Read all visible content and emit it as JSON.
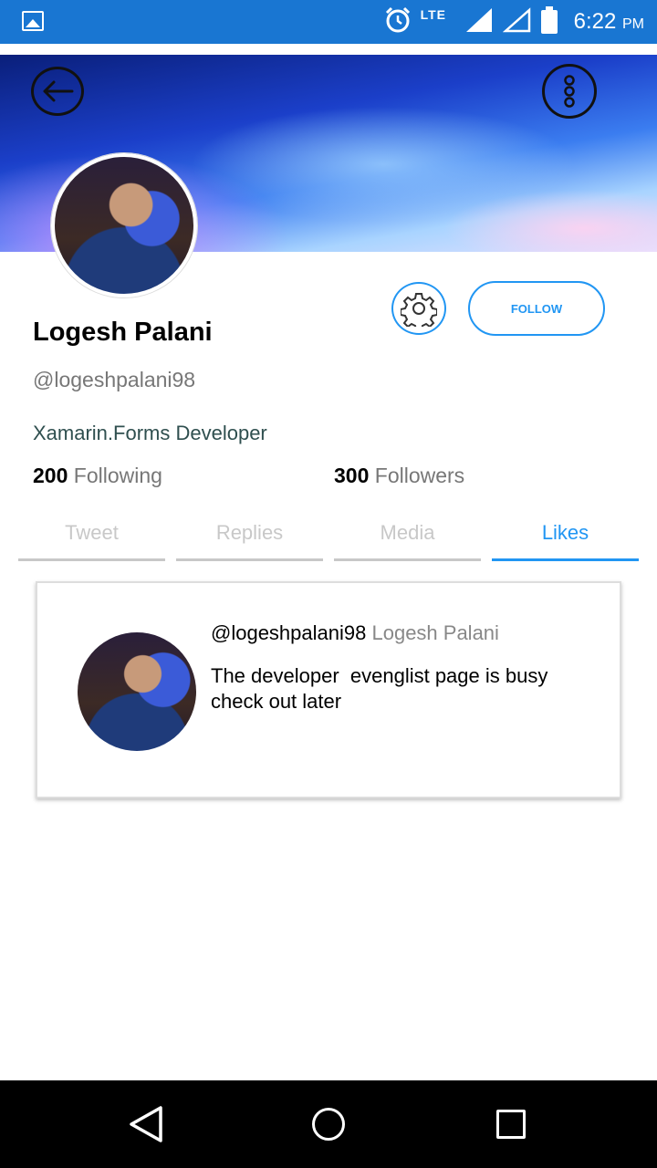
{
  "status_bar": {
    "time": "6:22",
    "ampm": "PM",
    "network": "LTE",
    "icons": [
      "gallery-icon",
      "alarm-icon",
      "lte-icon",
      "signal-icon",
      "signal-empty-icon",
      "battery-icon"
    ]
  },
  "header": {
    "back_icon": "arrow-left-icon",
    "more_icon": "more-vertical-icon"
  },
  "profile": {
    "name": "Logesh Palani",
    "handle": "@logeshpalani98",
    "bio": "Xamarin.Forms Developer",
    "following_count": "200",
    "following_label": "Following",
    "followers_count": "300",
    "followers_label": "Followers",
    "follow_button": "FOLLOW",
    "settings_icon": "gear-icon"
  },
  "tabs": [
    {
      "label": "Tweet",
      "active": false
    },
    {
      "label": "Replies",
      "active": false
    },
    {
      "label": "Media",
      "active": false
    },
    {
      "label": "Likes",
      "active": true
    }
  ],
  "feed": [
    {
      "handle": "@logeshpalani98",
      "name": "Logesh Palani",
      "text": "The developer  evenglist page is busy check out later"
    }
  ],
  "colors": {
    "status_bar": "#1976d2",
    "accent": "#2196f3",
    "inactive_tab": "#c8c8c8"
  }
}
